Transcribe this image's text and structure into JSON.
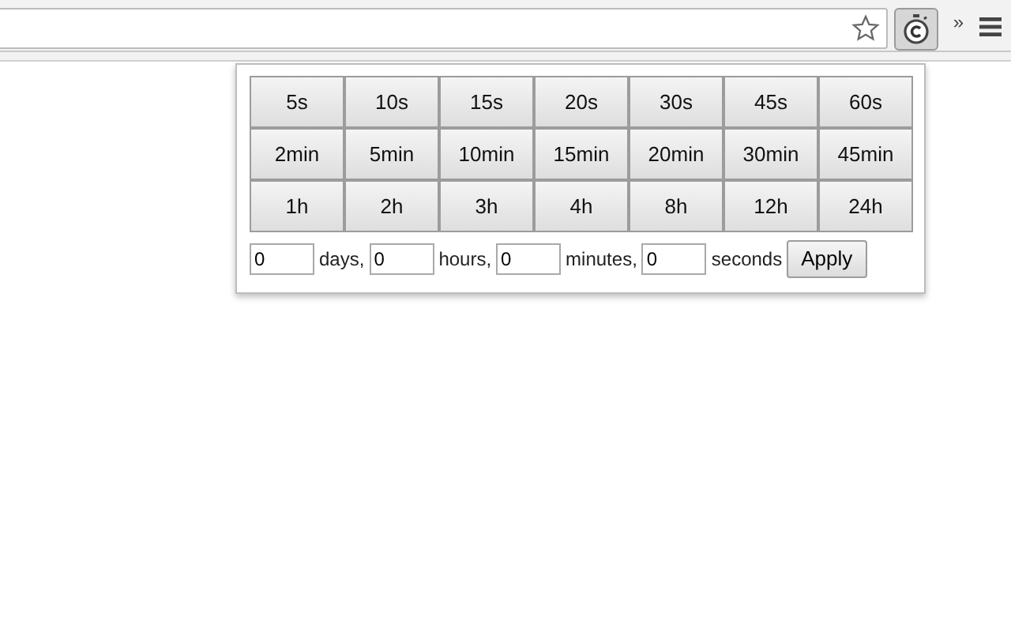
{
  "toolbar": {
    "overflow_chevron": "»"
  },
  "popup": {
    "preset_rows": [
      [
        "5s",
        "10s",
        "15s",
        "20s",
        "30s",
        "45s",
        "60s"
      ],
      [
        "2min",
        "5min",
        "10min",
        "15min",
        "20min",
        "30min",
        "45min"
      ],
      [
        "1h",
        "2h",
        "3h",
        "4h",
        "8h",
        "12h",
        "24h"
      ]
    ],
    "custom_row": [
      {
        "kind": "field",
        "value": "0"
      },
      {
        "kind": "text",
        "text": "days,"
      },
      {
        "kind": "field",
        "value": "0"
      },
      {
        "kind": "text",
        "text": "hours,"
      },
      {
        "kind": "field",
        "value": "0"
      },
      {
        "kind": "text",
        "text": "minutes,"
      },
      {
        "kind": "field",
        "value": "0"
      },
      {
        "kind": "text",
        "text": "seconds"
      }
    ],
    "apply_button": "Apply"
  }
}
